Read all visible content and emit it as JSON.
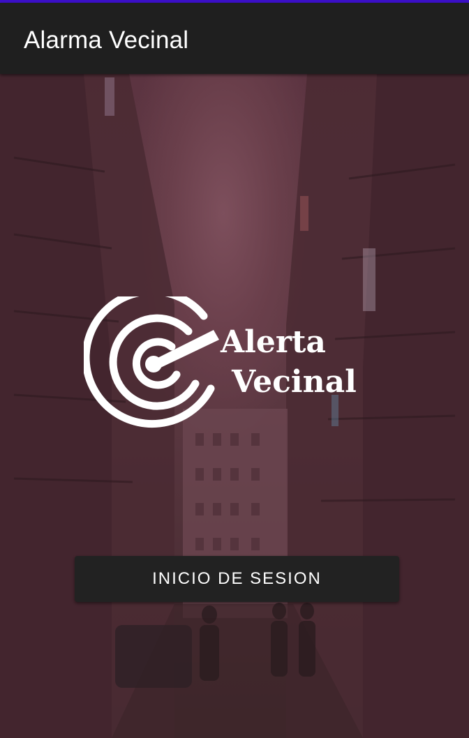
{
  "app_bar": {
    "title": "Alarma Vecinal"
  },
  "logo": {
    "icon": "radar-icon",
    "line1": "Alerta",
    "line2": "Vecinal"
  },
  "actions": {
    "login_label": "INICIO DE SESION"
  },
  "colors": {
    "accent": "#3c10c8",
    "app_bar": "#1f1f1f",
    "button": "#222222",
    "overlay": "#5a3640"
  }
}
